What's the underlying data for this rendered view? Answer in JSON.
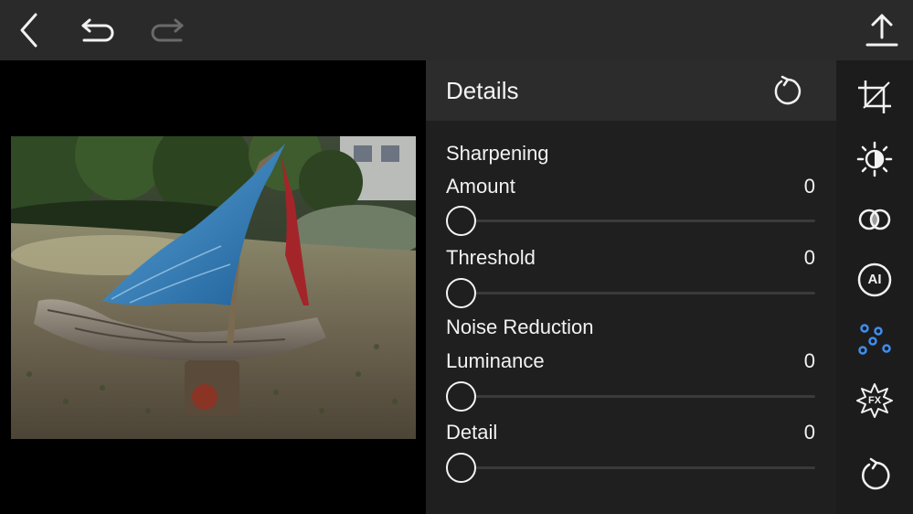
{
  "toolbar": {
    "back_icon": "chevron-left-icon",
    "undo_icon": "undo-icon",
    "redo_icon": "redo-icon",
    "redo_enabled": false,
    "export_icon": "upload-icon"
  },
  "panel": {
    "title": "Details",
    "reset_icon": "reset-icon",
    "sections": [
      {
        "title": "Sharpening",
        "sliders": [
          {
            "label": "Amount",
            "value": "0"
          },
          {
            "label": "Threshold",
            "value": "0"
          }
        ]
      },
      {
        "title": "Noise Reduction",
        "sliders": [
          {
            "label": "Luminance",
            "value": "0"
          },
          {
            "label": "Detail",
            "value": "0"
          }
        ]
      }
    ]
  },
  "tools": [
    {
      "name": "crop-icon",
      "active": false
    },
    {
      "name": "light-icon",
      "active": false
    },
    {
      "name": "color-icon",
      "active": false
    },
    {
      "name": "ai-icon",
      "label": "AI",
      "active": false
    },
    {
      "name": "details-icon",
      "active": true
    },
    {
      "name": "effects-icon",
      "label": "FX",
      "active": false
    },
    {
      "name": "reset-all-icon",
      "active": false
    }
  ],
  "colors": {
    "accent": "#3d8ef0",
    "topbar_bg": "#2a2a2a",
    "panel_header_bg": "#2c2c2c",
    "panel_bg": "#1f1f1f",
    "icon": "#f2f2f2",
    "disabled_icon": "#6a6a6a"
  }
}
